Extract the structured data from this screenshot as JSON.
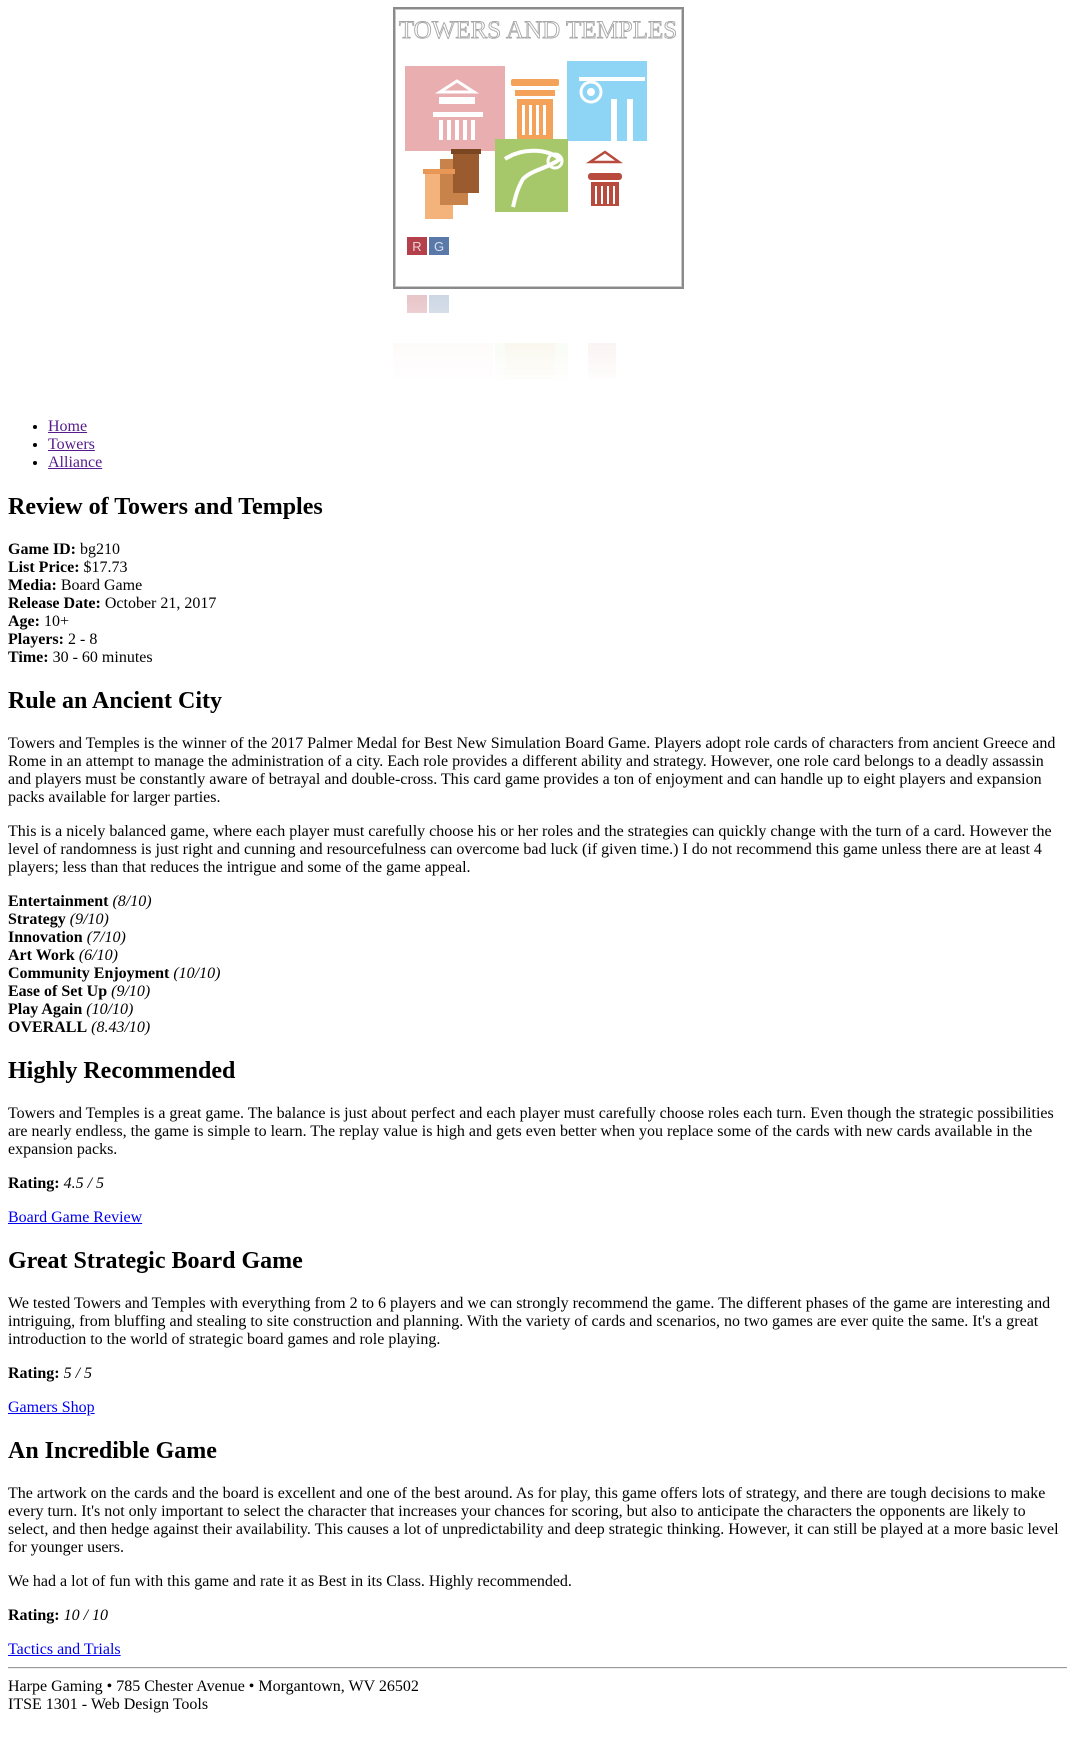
{
  "logo": {
    "title": "TOWERS AND TEMPLES",
    "badge_left": "R",
    "badge_right": "G",
    "colors": {
      "pink": "#e8aeb0",
      "orange": "#f4a25a",
      "sky": "#8dd4f5",
      "brown": "#a9693a",
      "green": "#a7c86a",
      "red": "#b84a3e",
      "badge_red": "#b3404a",
      "badge_blue": "#5a79a8"
    }
  },
  "nav": {
    "items": [
      {
        "label": "Home"
      },
      {
        "label": "Towers"
      },
      {
        "label": "Alliance"
      }
    ]
  },
  "page_title": "Review of Towers and Temples",
  "details": [
    {
      "label": "Game ID:",
      "value": "bg210"
    },
    {
      "label": "List Price:",
      "value": "$17.73"
    },
    {
      "label": "Media:",
      "value": "Board Game"
    },
    {
      "label": "Release Date:",
      "value": "October 21, 2017"
    },
    {
      "label": "Age:",
      "value": "10+"
    },
    {
      "label": "Players:",
      "value": "2 - 8"
    },
    {
      "label": "Time:",
      "value": "30 - 60 minutes"
    }
  ],
  "intro": {
    "heading": "Rule an Ancient City",
    "para1": "Towers and Temples is the winner of the 2017 Palmer Medal for Best New Simulation Board Game. Players adopt role cards of characters from ancient Greece and Rome in an attempt to manage the administration of a city. Each role provides a different ability and strategy. However, one role card belongs to a deadly assassin and players must be constantly aware of betrayal and double-cross. This card game provides a ton of enjoyment and can handle up to eight players and expansion packs available for larger parties.",
    "para2": "This is a nicely balanced game, where each player must carefully choose his or her roles and the strategies can quickly change with the turn of a card. However the level of randomness is just right and cunning and resourcefulness can overcome bad luck (if given time.) I do not recommend this game unless there are at least 4 players; less than that reduces the intrigue and some of the game appeal."
  },
  "scores": [
    {
      "label": "Entertainment",
      "value": "(8/10)"
    },
    {
      "label": "Strategy",
      "value": "(9/10)"
    },
    {
      "label": "Innovation",
      "value": "(7/10)"
    },
    {
      "label": "Art Work",
      "value": "(6/10)"
    },
    {
      "label": "Community Enjoyment",
      "value": "(10/10)"
    },
    {
      "label": "Ease of Set Up",
      "value": "(9/10)"
    },
    {
      "label": "Play Again",
      "value": "(10/10)"
    },
    {
      "label": "OVERALL",
      "value": "(8.43/10)"
    }
  ],
  "reviews": [
    {
      "heading": "Highly Recommended",
      "paras": [
        "Towers and Temples is a great game. The balance is just about perfect and each player must carefully choose roles each turn. Even though the strategic possibilities are nearly endless, the game is simple to learn. The replay value is high and gets even better when you replace some of the cards with new cards available in the expansion packs."
      ],
      "rating_label": "Rating:",
      "rating_value": "4.5 / 5",
      "source": "Board Game Review"
    },
    {
      "heading": "Great Strategic Board Game",
      "paras": [
        "We tested Towers and Temples with everything from 2 to 6 players and we can strongly recommend the game. The different phases of the game are interesting and intriguing, from bluffing and stealing to site construction and planning. With the variety of cards and scenarios, no two games are ever quite the same. It's a great introduction to the world of strategic board games and role playing."
      ],
      "rating_label": "Rating:",
      "rating_value": "5 / 5",
      "source": "Gamers Shop"
    },
    {
      "heading": "An Incredible Game",
      "paras": [
        "The artwork on the cards and the board is excellent and one of the best around. As for play, this game offers lots of strategy, and there are tough decisions to make every turn. It's not only important to select the character that increases your chances for scoring, but also to anticipate the characters the opponents are likely to select, and then hedge against their availability. This causes a lot of unpredictability and deep strategic thinking. However, it can still be played at a more basic level for younger users.",
        "We had a lot of fun with this game and rate it as Best in its Class. Highly recommended."
      ],
      "rating_label": "Rating:",
      "rating_value": "10 / 10",
      "source": "Tactics and Trials"
    }
  ],
  "footer": {
    "address": "Harpe Gaming • 785 Chester Avenue • Morgantown, WV 26502",
    "course": "ITSE 1301 - Web Design Tools"
  }
}
